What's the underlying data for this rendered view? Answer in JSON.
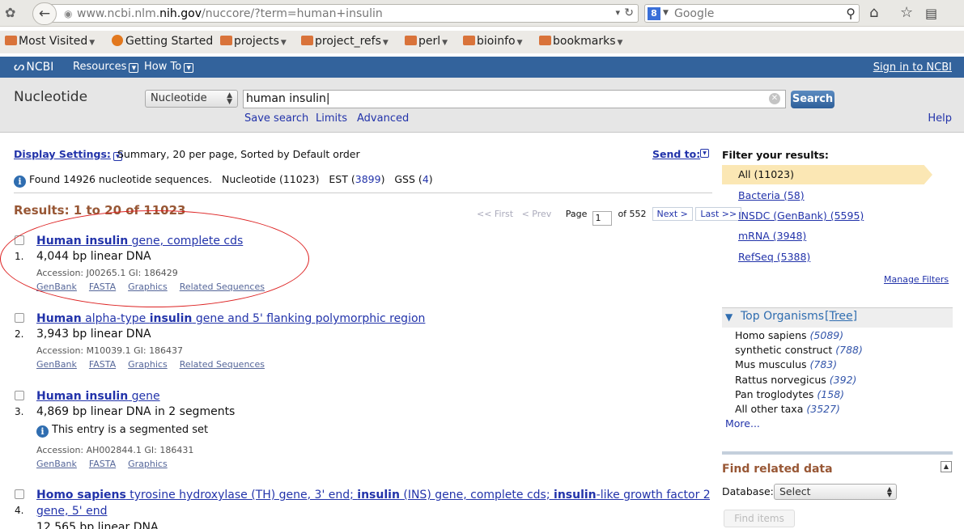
{
  "browser": {
    "url_prefix": "www.ncbi.nlm.",
    "url_domain": "nih.gov",
    "url_suffix": "/nuccore/?term=human+insulin",
    "search_placeholder": "Google",
    "bookmarks": [
      {
        "label": "Most Visited",
        "icon": "most-visited-icon"
      },
      {
        "label": "Getting Started",
        "icon": "firefox-icon"
      },
      {
        "label": "projects",
        "icon": "folder-icon"
      },
      {
        "label": "project_refs",
        "icon": "folder-icon"
      },
      {
        "label": "perl",
        "icon": "folder-icon"
      },
      {
        "label": "bioinfo",
        "icon": "folder-icon"
      },
      {
        "label": "bookmarks",
        "icon": "folder-icon"
      }
    ]
  },
  "ncbi": {
    "logo": "NCBI",
    "resources": "Resources",
    "howto": "How To",
    "signin": "Sign in to NCBI"
  },
  "search": {
    "db_title": "Nucleotide",
    "db_selected": "Nucleotide",
    "term": "human insulin",
    "button": "Search",
    "save_search": "Save search",
    "limits": "Limits",
    "advanced": "Advanced",
    "help": "Help"
  },
  "display": {
    "settings_label": "Display Settings:",
    "summary": "Summary, 20 per page, Sorted by Default order",
    "send_to": "Send to:",
    "found_text": "Found 14926 nucleotide sequences.",
    "nucleotide_count": "Nucleotide (11023)",
    "est_label": "EST",
    "est_count": "3899",
    "gss_label": "GSS",
    "gss_count": "4"
  },
  "results_heading": "Results: 1 to 20 of 11023",
  "pager": {
    "first": "<< First",
    "prev": "< Prev",
    "page_label": "Page",
    "page": "1",
    "of": "of 552",
    "next": "Next >",
    "last": "Last >>"
  },
  "results": [
    {
      "num": "1.",
      "title_bold": "Human insulin",
      "title_rest": " gene, complete cds",
      "desc": "4,044 bp linear DNA",
      "accession": "Accession: J00265.1   GI: 186429",
      "links": [
        "GenBank",
        "FASTA",
        "Graphics",
        "Related Sequences"
      ]
    },
    {
      "num": "2.",
      "title_b1": "Human",
      "title_m1": " alpha-type ",
      "title_b2": "insulin",
      "title_m2": " gene and 5' flanking polymorphic region",
      "desc": "3,943 bp linear DNA",
      "accession": "Accession: M10039.1   GI: 186437",
      "links": [
        "GenBank",
        "FASTA",
        "Graphics",
        "Related Sequences"
      ]
    },
    {
      "num": "3.",
      "title_bold": "Human insulin",
      "title_rest": " gene",
      "desc": "4,869 bp linear DNA in 2 segments",
      "note": "This entry is a segmented set",
      "accession": "Accession: AH002844.1   GI: 186431",
      "links": [
        "GenBank",
        "FASTA",
        "Graphics"
      ]
    },
    {
      "num": "4.",
      "t1": "Homo sapiens",
      "t2": " tyrosine hydroxylase (TH) gene, 3' end; ",
      "t3": "insulin",
      "t4": " (INS) gene, complete cds; ",
      "t5": "insulin",
      "t6": "-like growth factor 2 (IGF2)",
      "t7": "gene, 5' end",
      "desc": "12,565 bp linear DNA"
    }
  ],
  "filters": {
    "title": "Filter your results:",
    "items": [
      "All (11023)",
      "Bacteria (58)",
      "INSDC (GenBank) (5595)",
      "mRNA (3948)",
      "RefSeq (5388)"
    ],
    "manage": "Manage Filters"
  },
  "organisms": {
    "title": "Top Organisms",
    "tree": "[Tree]",
    "items": [
      {
        "name": "Homo sapiens",
        "count": "(5089)"
      },
      {
        "name": "synthetic construct",
        "count": "(788)"
      },
      {
        "name": "Mus musculus",
        "count": "(783)"
      },
      {
        "name": "Rattus norvegicus",
        "count": "(392)"
      },
      {
        "name": "Pan troglodytes",
        "count": "(158)"
      },
      {
        "name": "All other taxa",
        "count": "(3527)"
      }
    ],
    "more": "More..."
  },
  "related": {
    "title": "Find related data",
    "db_label": "Database:",
    "select": "Select",
    "button": "Find items"
  },
  "colors": {
    "ncbi_blue": "#33639c",
    "results_brown": "#985735",
    "link_blue": "#2233aa",
    "filter_active": "#fbe7b4",
    "annotation_red": "#d22222"
  }
}
